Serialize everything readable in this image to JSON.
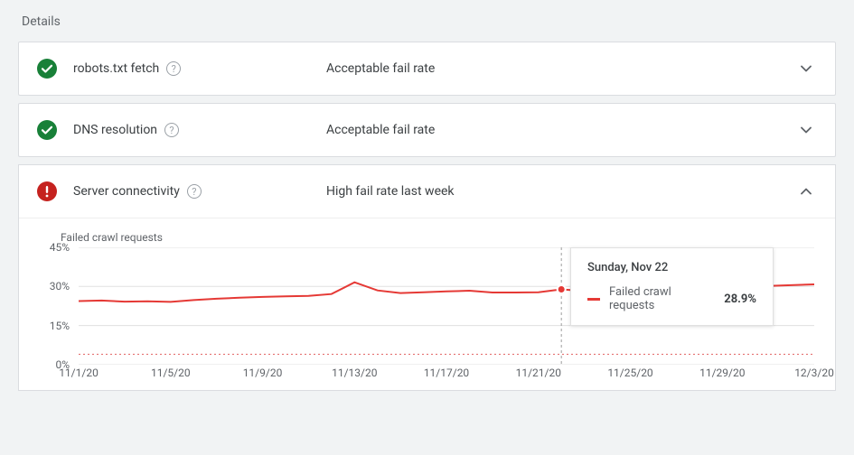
{
  "section_title": "Details",
  "rows": [
    {
      "label": "robots.txt fetch",
      "status": "Acceptable fail rate"
    },
    {
      "label": "DNS resolution",
      "status": "Acceptable fail rate"
    },
    {
      "label": "Server connectivity",
      "status": "High fail rate last week"
    }
  ],
  "chart_title": "Failed crawl requests",
  "tooltip": {
    "title": "Sunday, Nov 22",
    "label": "Failed crawl requests",
    "value": "28.9%"
  },
  "yticks": [
    "45%",
    "30%",
    "15%",
    "0%"
  ],
  "xticks": [
    "11/1/20",
    "11/5/20",
    "11/9/20",
    "11/13/20",
    "11/17/20",
    "11/21/20",
    "11/25/20",
    "11/29/20",
    "12/3/20"
  ],
  "chart_data": {
    "type": "line",
    "title": "Failed crawl requests",
    "xlabel": "",
    "ylabel": "Failed crawl requests (%)",
    "ylim": [
      0,
      45
    ],
    "threshold": 4,
    "x": [
      "11/1/20",
      "11/2/20",
      "11/3/20",
      "11/4/20",
      "11/5/20",
      "11/6/20",
      "11/7/20",
      "11/8/20",
      "11/9/20",
      "11/10/20",
      "11/11/20",
      "11/12/20",
      "11/13/20",
      "11/14/20",
      "11/15/20",
      "11/16/20",
      "11/17/20",
      "11/18/20",
      "11/19/20",
      "11/20/20",
      "11/21/20",
      "11/22/20",
      "11/23/20",
      "11/24/20",
      "11/25/20",
      "11/26/20",
      "11/27/20",
      "11/28/20",
      "11/29/20",
      "11/30/20",
      "12/1/20",
      "12/2/20",
      "12/3/20"
    ],
    "values": [
      24.4,
      24.6,
      24.2,
      24.3,
      24.1,
      24.8,
      25.3,
      25.7,
      26.0,
      26.2,
      26.4,
      27.1,
      31.6,
      28.5,
      27.5,
      27.8,
      28.1,
      28.4,
      27.7,
      27.7,
      27.8,
      28.9,
      28.2,
      29.5,
      30.2,
      29.6,
      29.3,
      29.8,
      30.4,
      30.0,
      30.2,
      30.5,
      30.8
    ],
    "highlight": {
      "x": "11/22/20",
      "value": 28.9
    },
    "xticks": [
      "11/1/20",
      "11/5/20",
      "11/9/20",
      "11/13/20",
      "11/17/20",
      "11/21/20",
      "11/25/20",
      "11/29/20",
      "12/3/20"
    ]
  }
}
